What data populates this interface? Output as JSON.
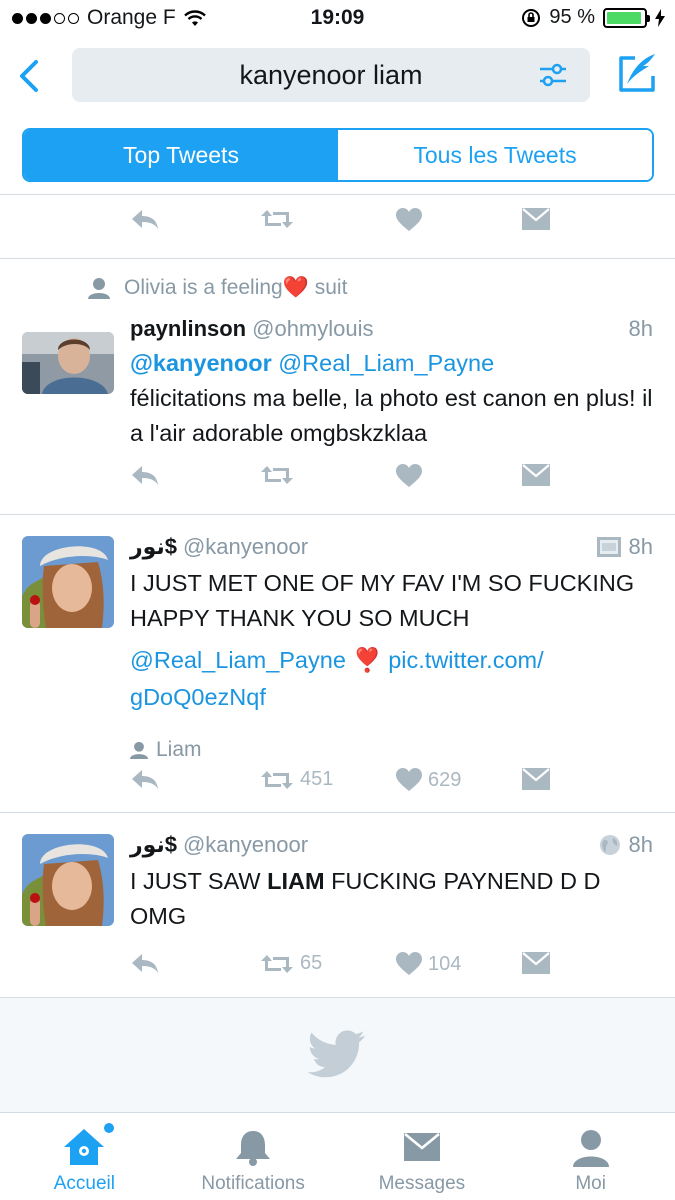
{
  "status": {
    "carrier": "Orange F",
    "time": "19:09",
    "battery_pct": "95 %",
    "battery_fill": 0.95
  },
  "search": {
    "query": "kanyenoor liam"
  },
  "tabs": {
    "top": "Top Tweets",
    "all": "Tous les Tweets"
  },
  "tweets": [
    {
      "context": "Olivia is a feeling❤️ suit",
      "name": "paynlinson",
      "handle": "@ohmylouis",
      "time": "8h",
      "mention1": "@kanyenoor",
      "mention2": "@Real_Liam_Payne",
      "text": "félicitations ma belle, la photo est canon en plus! il a l'air adorable omgbskzklaa"
    },
    {
      "name": "نور$",
      "handle": "@kanyenoor",
      "time": "8h",
      "text": "I JUST MET ONE OF MY FAV I'M SO FUCKING HAPPY THANK YOU SO MUCH",
      "mention": "@Real_Liam_Payne",
      "emoji": "❣️",
      "link1": "pic.twitter.com/",
      "link2": "gDoQ0ezNqf",
      "tag": "Liam",
      "retweets": "451",
      "likes": "629"
    },
    {
      "name": "نور$",
      "handle": "@kanyenoor",
      "time": "8h",
      "text_pre": "I JUST SAW ",
      "text_bold": "LIAM",
      "text_post": " FUCKING PAYNEND D D OMG",
      "retweets": "65",
      "likes": "104"
    }
  ],
  "tabbar": {
    "home": "Accueil",
    "notifications": "Notifications",
    "messages": "Messages",
    "me": "Moi"
  },
  "colors": {
    "accent": "#1da1f2",
    "muted": "#aab8c2",
    "gray_text": "#8899a6"
  }
}
